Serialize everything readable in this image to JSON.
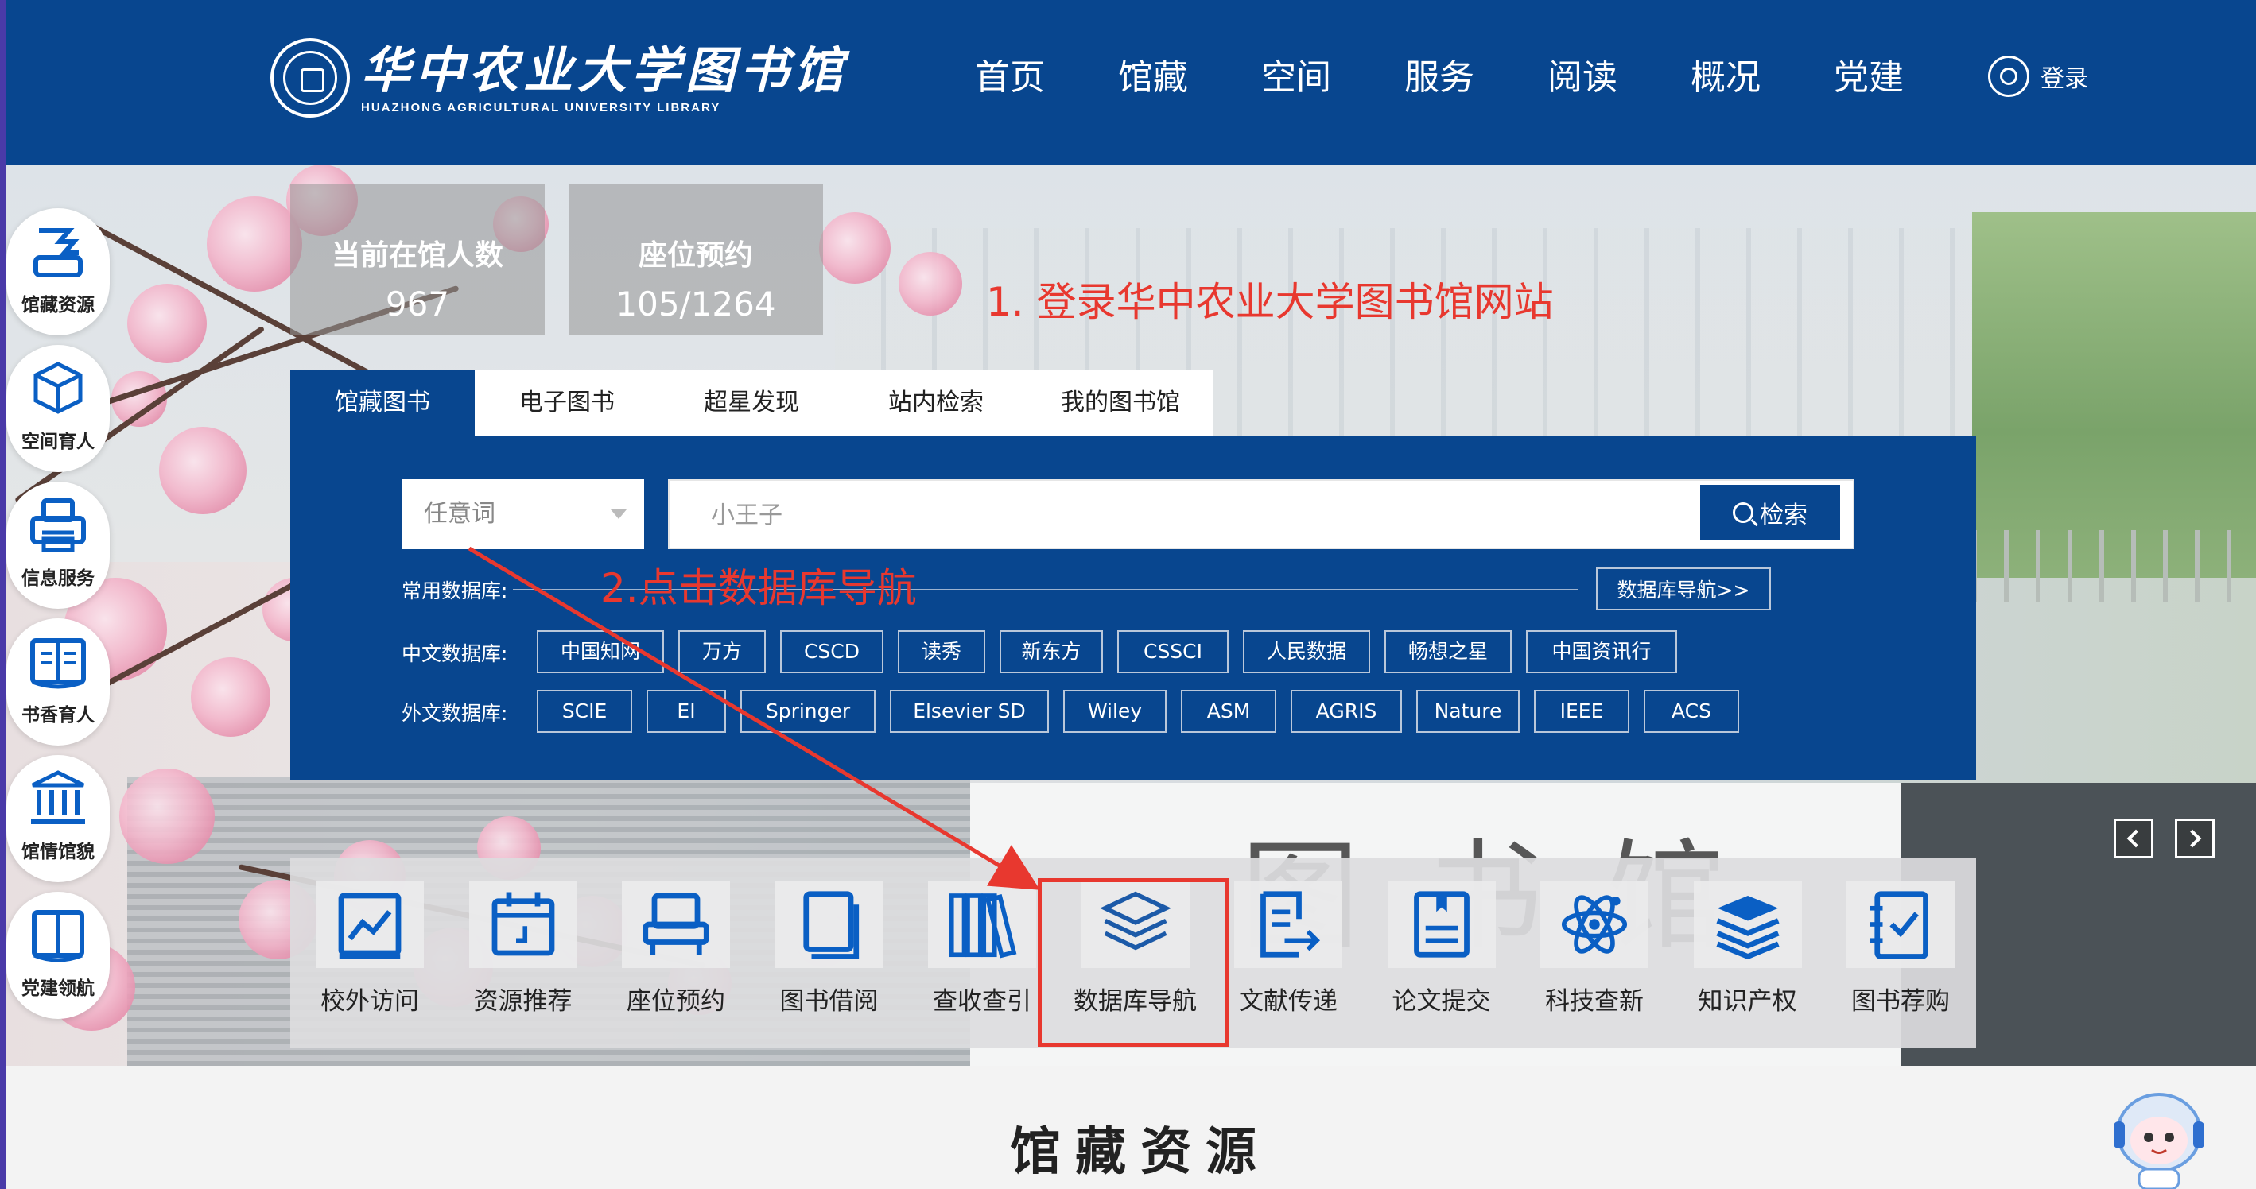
{
  "header": {
    "logo_cn": "华中农业大学图书馆",
    "logo_en": "HUAZHONG AGRICULTURAL UNIVERSITY LIBRARY",
    "nav": [
      "首页",
      "馆藏",
      "空间",
      "服务",
      "阅读",
      "概况",
      "党建"
    ],
    "login": "登录"
  },
  "stats": [
    {
      "label": "当前在馆人数",
      "value": "967"
    },
    {
      "label": "座位预约",
      "value": "105/1264"
    }
  ],
  "annotations": {
    "step1": "1. 登录华中农业大学图书馆网站",
    "step2": "2.点击数据库导航"
  },
  "search": {
    "tabs": [
      "馆藏图书",
      "电子图书",
      "超星发现",
      "站内检索",
      "我的图书馆"
    ],
    "active_tab": 0,
    "select_value": "任意词",
    "input_placeholder": "小王子",
    "button": "检索",
    "common_label": "常用数据库:",
    "db_nav": "数据库导航>>",
    "cn_label": "中文数据库:",
    "cn_dbs": [
      "中国知网",
      "万方",
      "CSCD",
      "读秀",
      "新东方",
      "CSSCI",
      "人民数据",
      "畅想之星",
      "中国资讯行"
    ],
    "en_label": "外文数据库:",
    "en_dbs": [
      "SCIE",
      "EI",
      "Springer",
      "Elsevier SD",
      "Wiley",
      "ASM",
      "AGRIS",
      "Nature",
      "IEEE",
      "ACS"
    ]
  },
  "quick_links": [
    {
      "label": "校外访问",
      "icon": "chart-icon"
    },
    {
      "label": "资源推荐",
      "icon": "calendar-icon"
    },
    {
      "label": "座位预约",
      "icon": "seat-icon"
    },
    {
      "label": "图书借阅",
      "icon": "book-icon"
    },
    {
      "label": "查收查引",
      "icon": "books-shelf-icon"
    },
    {
      "label": "数据库导航",
      "icon": "layers-icon"
    },
    {
      "label": "文献传递",
      "icon": "document-send-icon"
    },
    {
      "label": "论文提交",
      "icon": "thesis-icon"
    },
    {
      "label": "科技查新",
      "icon": "atom-icon"
    },
    {
      "label": "知识产权",
      "icon": "book-stack-icon"
    },
    {
      "label": "图书荐购",
      "icon": "notebook-check-icon"
    }
  ],
  "highlighted_link": "数据库导航",
  "side_menu": [
    {
      "label": "馆藏资源",
      "icon": "collection-icon"
    },
    {
      "label": "空间育人",
      "icon": "cube-icon"
    },
    {
      "label": "信息服务",
      "icon": "printer-icon"
    },
    {
      "label": "书香育人",
      "icon": "open-book-icon"
    },
    {
      "label": "馆情馆貌",
      "icon": "building-icon"
    },
    {
      "label": "党建领航",
      "icon": "book-outline-icon"
    }
  ],
  "section_title": "馆藏资源",
  "colors": {
    "brand": "#08468f",
    "annotation": "#e8382f",
    "icon_blue": "#0a5fc4"
  }
}
